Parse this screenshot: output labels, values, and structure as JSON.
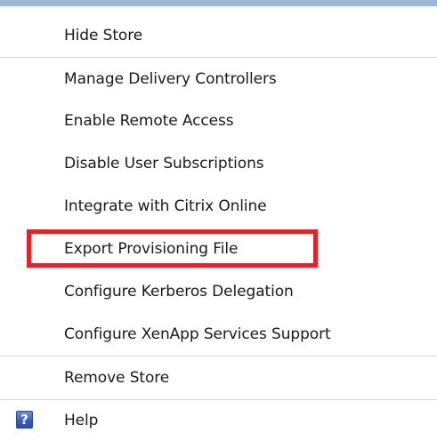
{
  "menu": {
    "items": [
      {
        "label": "Hide Store"
      },
      {
        "label": "Manage Delivery Controllers"
      },
      {
        "label": "Enable Remote Access"
      },
      {
        "label": "Disable User Subscriptions"
      },
      {
        "label": "Integrate with Citrix Online"
      },
      {
        "label": "Export Provisioning File"
      },
      {
        "label": "Configure Kerberos Delegation"
      },
      {
        "label": "Configure XenApp Services Support"
      },
      {
        "label": "Remove Store"
      },
      {
        "label": "Help"
      }
    ],
    "help_icon_glyph": "?"
  },
  "highlight": {
    "target": "Export Provisioning File",
    "color": "#e8202a"
  },
  "colors": {
    "top_bar": "#9db7d9",
    "separator": "#d9d9d9",
    "help_icon": "#3a5fbf"
  },
  "icons": {
    "help": "help-icon"
  }
}
